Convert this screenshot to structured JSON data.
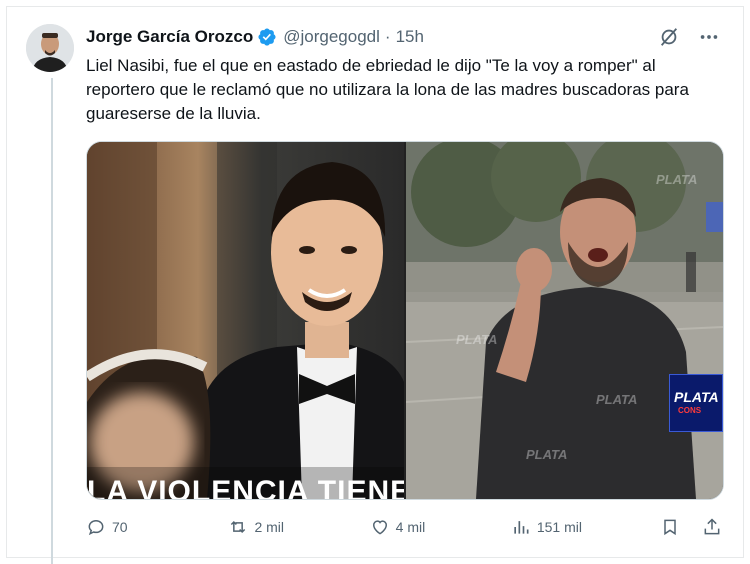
{
  "tweet": {
    "author_name": "Jorge García Orozco",
    "handle": "@jorgegogdl",
    "separator": "·",
    "time": "15h",
    "text": "Liel Nasibi, fue el que en eastado de ebriedad le dijo \"Te la voy a romper\" al reportero que le reclamó que no utilizara la lona de las madres buscadoras para guareserse de la lluvia.",
    "media": {
      "left_overlay_text": "LA VIOLENCIA TIENE",
      "right_watermark": "PLATA",
      "right_logo_text": "PLATA",
      "right_logo_subtext": "CONS"
    },
    "stats": {
      "replies": "70",
      "reposts": "2 mil",
      "likes": "4 mil",
      "views": "151 mil"
    }
  },
  "colors": {
    "verified": "#1d9bf0",
    "secondary_text": "#536471",
    "border": "#e7e9ea"
  },
  "icons": [
    "verified-badge-icon",
    "grok-icon",
    "more-icon",
    "reply-icon",
    "repost-icon",
    "like-icon",
    "views-icon",
    "bookmark-icon",
    "share-icon"
  ]
}
